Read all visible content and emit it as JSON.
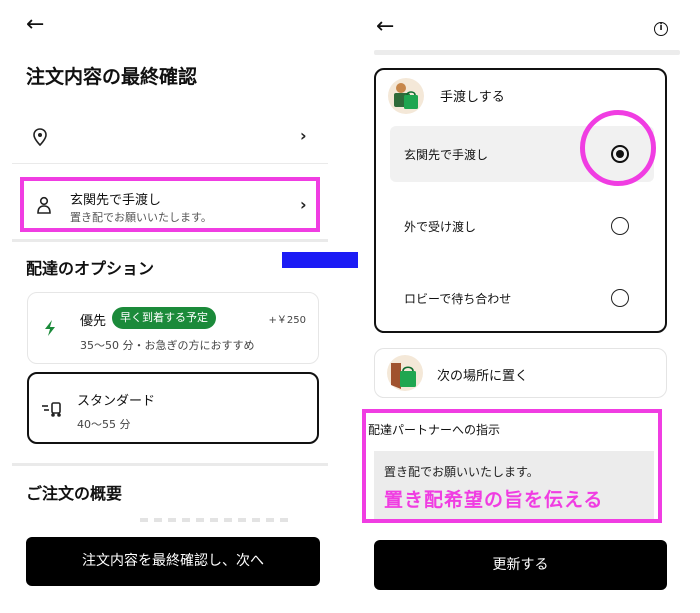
{
  "left_screen": {
    "title": "注文内容の最終確認",
    "delivery_address": {
      "icon": "location-pin-icon"
    },
    "handoff": {
      "title": "玄関先で手渡し",
      "note": "置き配でお願いいたします。",
      "icon": "person-icon"
    },
    "options_section": {
      "title": "配達のオプション",
      "options": [
        {
          "name": "優先",
          "badge": "早く到着する予定",
          "price": "+￥250",
          "description": "35〜50 分・お急ぎの方におすすめ",
          "icon": "bolt-icon"
        },
        {
          "name": "スタンダード",
          "description": "40〜55 分",
          "icon": "scooter-icon",
          "selected": true
        }
      ]
    },
    "summary_title": "ご注文の概要",
    "confirm_button": "注文内容を最終確認し、次へ"
  },
  "right_screen": {
    "handoff_heading": "手渡しする",
    "handoff_options": [
      {
        "label": "玄関先で手渡し",
        "selected": true
      },
      {
        "label": "外で受け渡し",
        "selected": false
      },
      {
        "label": "ロビーで待ち合わせ",
        "selected": false
      }
    ],
    "leave_at_place": "次の場所に置く",
    "instructions": {
      "title": "配達パートナーへの指示",
      "value": "置き配でお願いいたします。",
      "annotation": "置き配希望の旨を伝える"
    },
    "update_button": "更新する"
  },
  "colors": {
    "highlight": "#f03de2",
    "badge_green": "#1b8a3a",
    "arrow_blue": "#1b1bf5",
    "button_black": "#000000"
  }
}
